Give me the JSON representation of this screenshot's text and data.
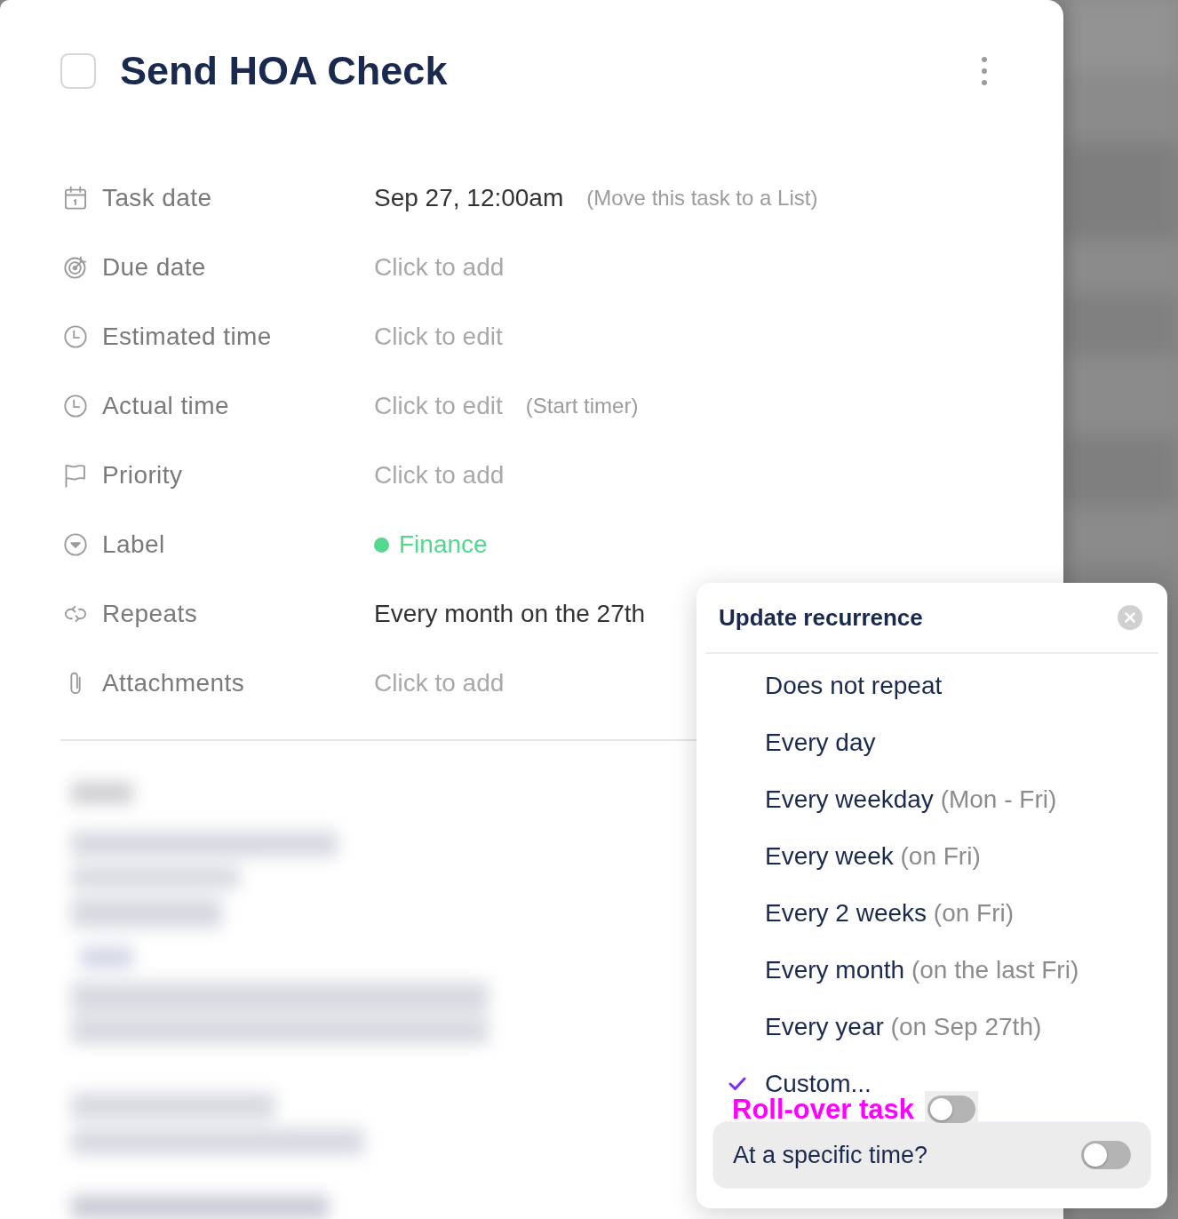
{
  "task": {
    "title": "Send HOA Check",
    "completed": false
  },
  "fields": [
    {
      "kind": "text",
      "label": "Task date",
      "value": "Sep 27, 12:00am",
      "link": "(Move this task to a List)"
    },
    {
      "kind": "text",
      "label": "Due date",
      "placeholder": "Click to add"
    },
    {
      "kind": "text",
      "label": "Estimated time",
      "placeholder": "Click to edit"
    },
    {
      "kind": "text",
      "label": "Actual time",
      "placeholder": "Click to edit",
      "link": "(Start timer)"
    },
    {
      "kind": "text",
      "label": "Priority",
      "placeholder": "Click to add"
    },
    {
      "kind": "tag",
      "label": "Label",
      "value": "Finance",
      "color": "#52d98e"
    },
    {
      "kind": "text",
      "label": "Repeats",
      "value": "Every month on the 27th"
    },
    {
      "kind": "text",
      "label": "Attachments",
      "placeholder": "Click to add"
    }
  ],
  "recurrence_popover": {
    "title": "Update recurrence",
    "options": [
      {
        "label": "Does not repeat",
        "selected": false
      },
      {
        "label": "Every day",
        "selected": false
      },
      {
        "label": "Every weekday",
        "detail": "(Mon - Fri)",
        "selected": false
      },
      {
        "label": "Every week",
        "detail": "(on Fri)",
        "selected": false
      },
      {
        "label": "Every 2 weeks",
        "detail": "(on Fri)",
        "selected": false
      },
      {
        "label": "Every month",
        "detail": "(on the last Fri)",
        "selected": false
      },
      {
        "label": "Every year",
        "detail": "(on Sep 27th)",
        "selected": false
      },
      {
        "label": "Custom...",
        "selected": true
      }
    ],
    "rollover": {
      "label": "Roll-over task",
      "on": false
    },
    "specific_time": {
      "label": "At a specific time?",
      "on": false
    }
  }
}
